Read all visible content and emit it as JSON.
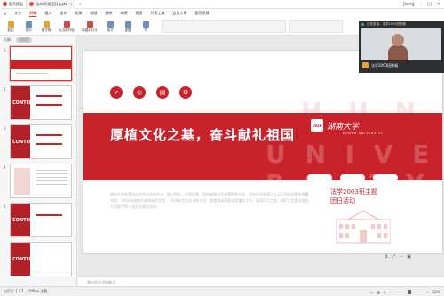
{
  "titlebar": {
    "tabs": [
      "稻壳模板",
      "法二(3)班团日.pptx"
    ],
    "user": "Jiang"
  },
  "ribbon": {
    "menu": [
      "文件",
      "开始",
      "插入",
      "设计",
      "切换",
      "动画",
      "放映",
      "审阅",
      "视图",
      "开发工具",
      "会员专享",
      "稻壳资源"
    ],
    "active_menu": "开始",
    "tools": [
      "粘贴",
      "剪切",
      "格式刷",
      "从当前开始",
      "新建幻灯片",
      "版式",
      "重置",
      "节"
    ]
  },
  "leftpane": {
    "tabs": [
      "大纲",
      "幻灯片"
    ],
    "slide_numbers": [
      "1",
      "2",
      "3",
      "4",
      "5"
    ],
    "thumb_content_label": "CONTENT"
  },
  "slide": {
    "title": "厚植文化之基，奋斗献礼祖国",
    "university_cn": "湖南大学",
    "university_en": "HUNAN UNIVERSITY",
    "seal_text": "1926",
    "watermark_1": "H U N A N",
    "watermark_2": "U N I V E R S I T Y",
    "subtitle_1": "法学2003班主题",
    "subtitle_2": "团日活动",
    "body": "湖南大学坐落在历史文化名城长沙，依山傍水，环境优美，校园被誉为没有围墙的大学。学校办学起源于公元976年创建的岳麓书院，1903年改制为湖南高等学堂，1926年定名为湖南大学，是教育部直属全国重点大学，国家211工程、985工程重点建设大学和世界一流大学建设高校。"
  },
  "notes": {
    "placeholder": "单击此处添加备注"
  },
  "statusbar": {
    "slide_info": "幻灯片 1 / 7",
    "theme": "Office 主题",
    "zoom": "62%"
  },
  "meeting": {
    "status": "正在讲话：法学2003班陈娴",
    "name": "法学2003班陈娴"
  }
}
